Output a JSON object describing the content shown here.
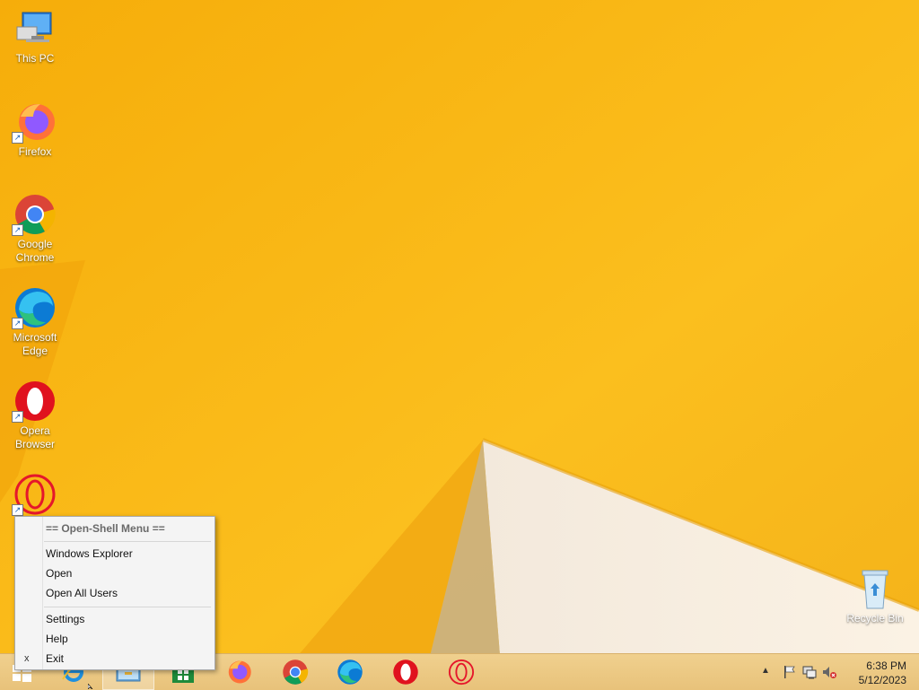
{
  "desktop": {
    "icons": [
      {
        "label": "This PC",
        "icon": "this-pc-icon"
      },
      {
        "label": "Firefox",
        "icon": "firefox-icon"
      },
      {
        "label": "Google Chrome",
        "icon": "chrome-icon"
      },
      {
        "label": "Microsoft Edge",
        "icon": "edge-icon"
      },
      {
        "label": "Opera Browser",
        "icon": "opera-icon"
      },
      {
        "label": "Recycle Bin",
        "icon": "recycle-bin-icon"
      }
    ]
  },
  "context_menu": {
    "header": "== Open-Shell Menu ==",
    "items": [
      "Windows Explorer",
      "Open",
      "Open All Users",
      "Settings",
      "Help",
      "Exit"
    ],
    "exit_mark": "x"
  },
  "taskbar": {
    "pinned": [
      "start-icon",
      "internet-explorer-icon",
      "file-explorer-icon",
      "store-icon",
      "firefox-icon",
      "chrome-icon",
      "edge-icon",
      "opera-icon",
      "opera-gx-icon"
    ],
    "active": "file-explorer-icon"
  },
  "tray": {
    "icons": [
      "show-hidden-icons-chevron-icon",
      "action-center-flag-icon",
      "network-icon",
      "volume-muted-icon"
    ],
    "time": "6:38 PM",
    "date": "5/12/2023"
  },
  "colors": {
    "wallpaper": "#f8b612",
    "taskbar": "#ecc780",
    "menu_bg": "#f4f4f4"
  }
}
